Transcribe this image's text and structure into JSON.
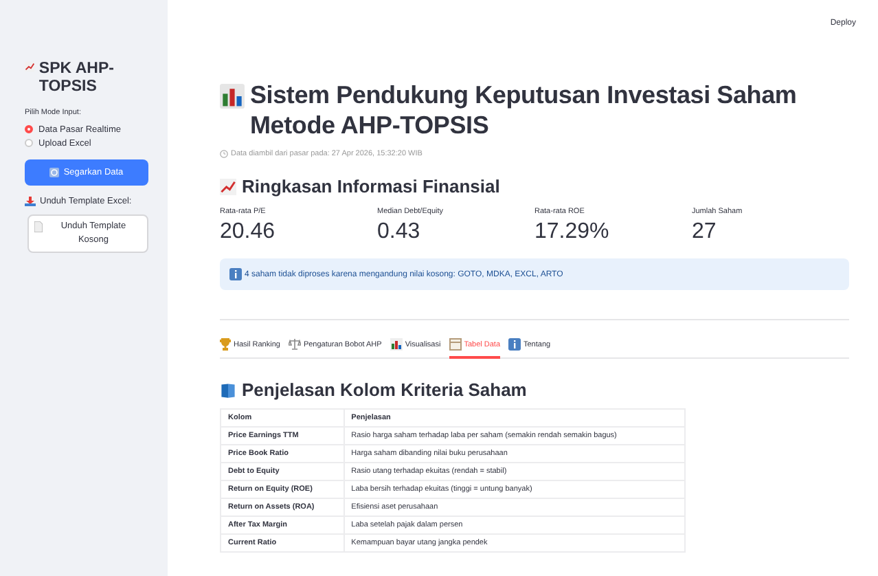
{
  "header": {
    "deploy": "Deploy"
  },
  "sidebar": {
    "title": "SPK AHP-TOPSIS",
    "mode_label": "Pilih Mode Input:",
    "modes": [
      {
        "label": "Data Pasar Realtime",
        "selected": true
      },
      {
        "label": "Upload Excel",
        "selected": false
      }
    ],
    "refresh_button": "Segarkan Data",
    "template_label": "Unduh Template Excel:",
    "template_button": "Unduh Template Kosong"
  },
  "main": {
    "title": "Sistem Pendukung Keputusan Investasi Saham Metode AHP-TOPSIS",
    "caption": "Data diambil dari pasar pada: 27 Apr 2026, 15:32:20 WIB",
    "summary_heading": "Ringkasan Informasi Finansial",
    "metrics": [
      {
        "label": "Rata-rata P/E",
        "value": "20.46"
      },
      {
        "label": "Median Debt/Equity",
        "value": "0.43"
      },
      {
        "label": "Rata-rata ROE",
        "value": "17.29%"
      },
      {
        "label": "Jumlah Saham",
        "value": "27"
      }
    ],
    "info": "4 saham tidak diproses karena mengandung nilai kosong: GOTO, MDKA, EXCL, ARTO",
    "tabs": [
      {
        "label": "Hasil Ranking",
        "selected": false
      },
      {
        "label": "Pengaturan Bobot AHP",
        "selected": false
      },
      {
        "label": "Visualisasi",
        "selected": false
      },
      {
        "label": "Tabel Data",
        "selected": true
      },
      {
        "label": "Tentang",
        "selected": false
      }
    ],
    "table_heading": "Penjelasan Kolom Kriteria Saham",
    "table": {
      "columns": [
        "Kolom",
        "Penjelasan"
      ],
      "rows": [
        [
          "Price Earnings TTM",
          "Rasio harga saham terhadap laba per saham (semakin rendah semakin bagus)"
        ],
        [
          "Price Book Ratio",
          "Harga saham dibanding nilai buku perusahaan"
        ],
        [
          "Debt to Equity",
          "Rasio utang terhadap ekuitas (rendah = stabil)"
        ],
        [
          "Return on Equity (ROE)",
          "Laba bersih terhadap ekuitas (tinggi = untung banyak)"
        ],
        [
          "Return on Assets (ROA)",
          "Efisiensi aset perusahaan"
        ],
        [
          "After Tax Margin",
          "Laba setelah pajak dalam persen"
        ],
        [
          "Current Ratio",
          "Kemampuan bayar utang jangka pendek"
        ]
      ]
    }
  }
}
